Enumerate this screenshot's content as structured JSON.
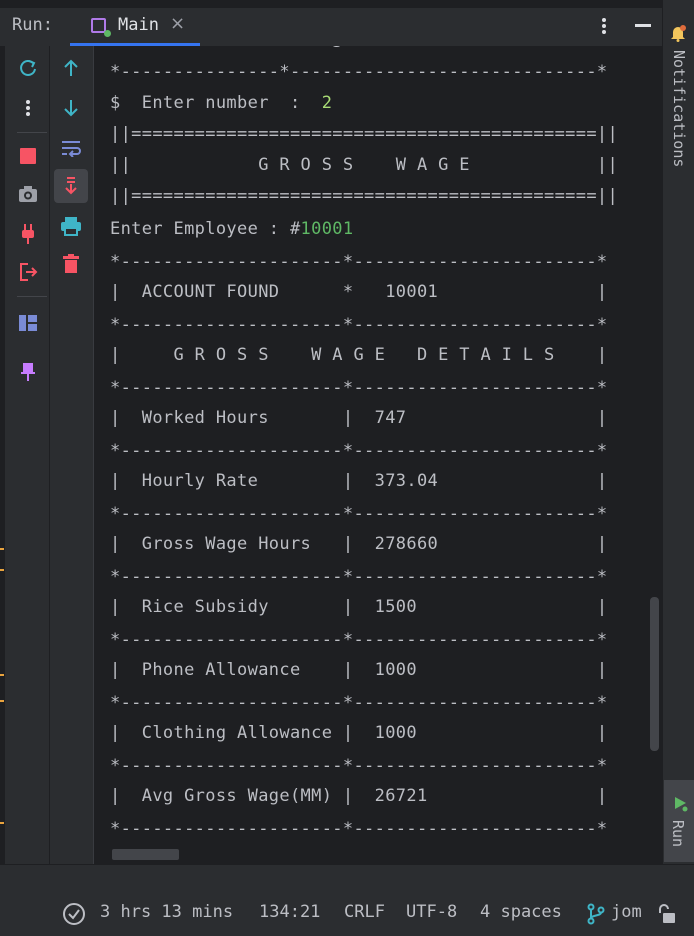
{
  "header": {
    "run_label": "Run:",
    "tab_label": "Main",
    "close_glyph": "×"
  },
  "console": {
    "lines": [
      "*---------------*-----------------------------*",
      "$  Enter number  :  ",
      "||============================================||",
      "||            G R O S S    W A G E            ||",
      "||============================================||",
      "Enter Employee : #",
      "*---------------------*-----------------------*",
      "|  ACCOUNT FOUND      *   10001               |",
      "*---------------------*-----------------------*",
      "|     G R O S S    W A G E   D E T A I L S    |",
      "*---------------------*-----------------------*",
      "|  Worked Hours       |  747                  |",
      "*---------------------*-----------------------*",
      "|  Hourly Rate        |  373.04               |",
      "*---------------------*-----------------------*",
      "|  Gross Wage Hours   |  278660               |",
      "*---------------------*-----------------------*",
      "|  Rice Subsidy       |  1500                 |",
      "*---------------------*-----------------------*",
      "|  Phone Allowance    |  1000                 |",
      "*---------------------*-----------------------*",
      "|  Clothing Allowance |  1000                 |",
      "*---------------------*-----------------------*",
      "|  Avg Gross Wage(MM) |  26721                |",
      "*---------------------*-----------------------*"
    ],
    "user_input_number": "2",
    "user_input_employee": "10001"
  },
  "right_sidebar": {
    "notifications_label": "Notifications",
    "run_label": "Run"
  },
  "status": {
    "time": "3 hrs 13 mins",
    "position": "134:21",
    "line_ending": "CRLF",
    "encoding": "UTF-8",
    "indent": "4 spaces",
    "branch": "jom"
  },
  "icons": {
    "left": [
      "rerun-icon",
      "more-icon",
      "stop-icon",
      "camera-icon",
      "plug-icon",
      "exit-icon",
      "layout-icon",
      "pin-icon"
    ],
    "middle": [
      "arrow-up-icon",
      "arrow-down-icon",
      "soft-wrap-icon",
      "scroll-to-end-icon",
      "print-icon",
      "trash-icon"
    ]
  },
  "colors": {
    "accent": "#3574f0",
    "input_green": "#5fb865",
    "stop_red": "#f75464",
    "tool_cyan": "#3fb5c7"
  }
}
